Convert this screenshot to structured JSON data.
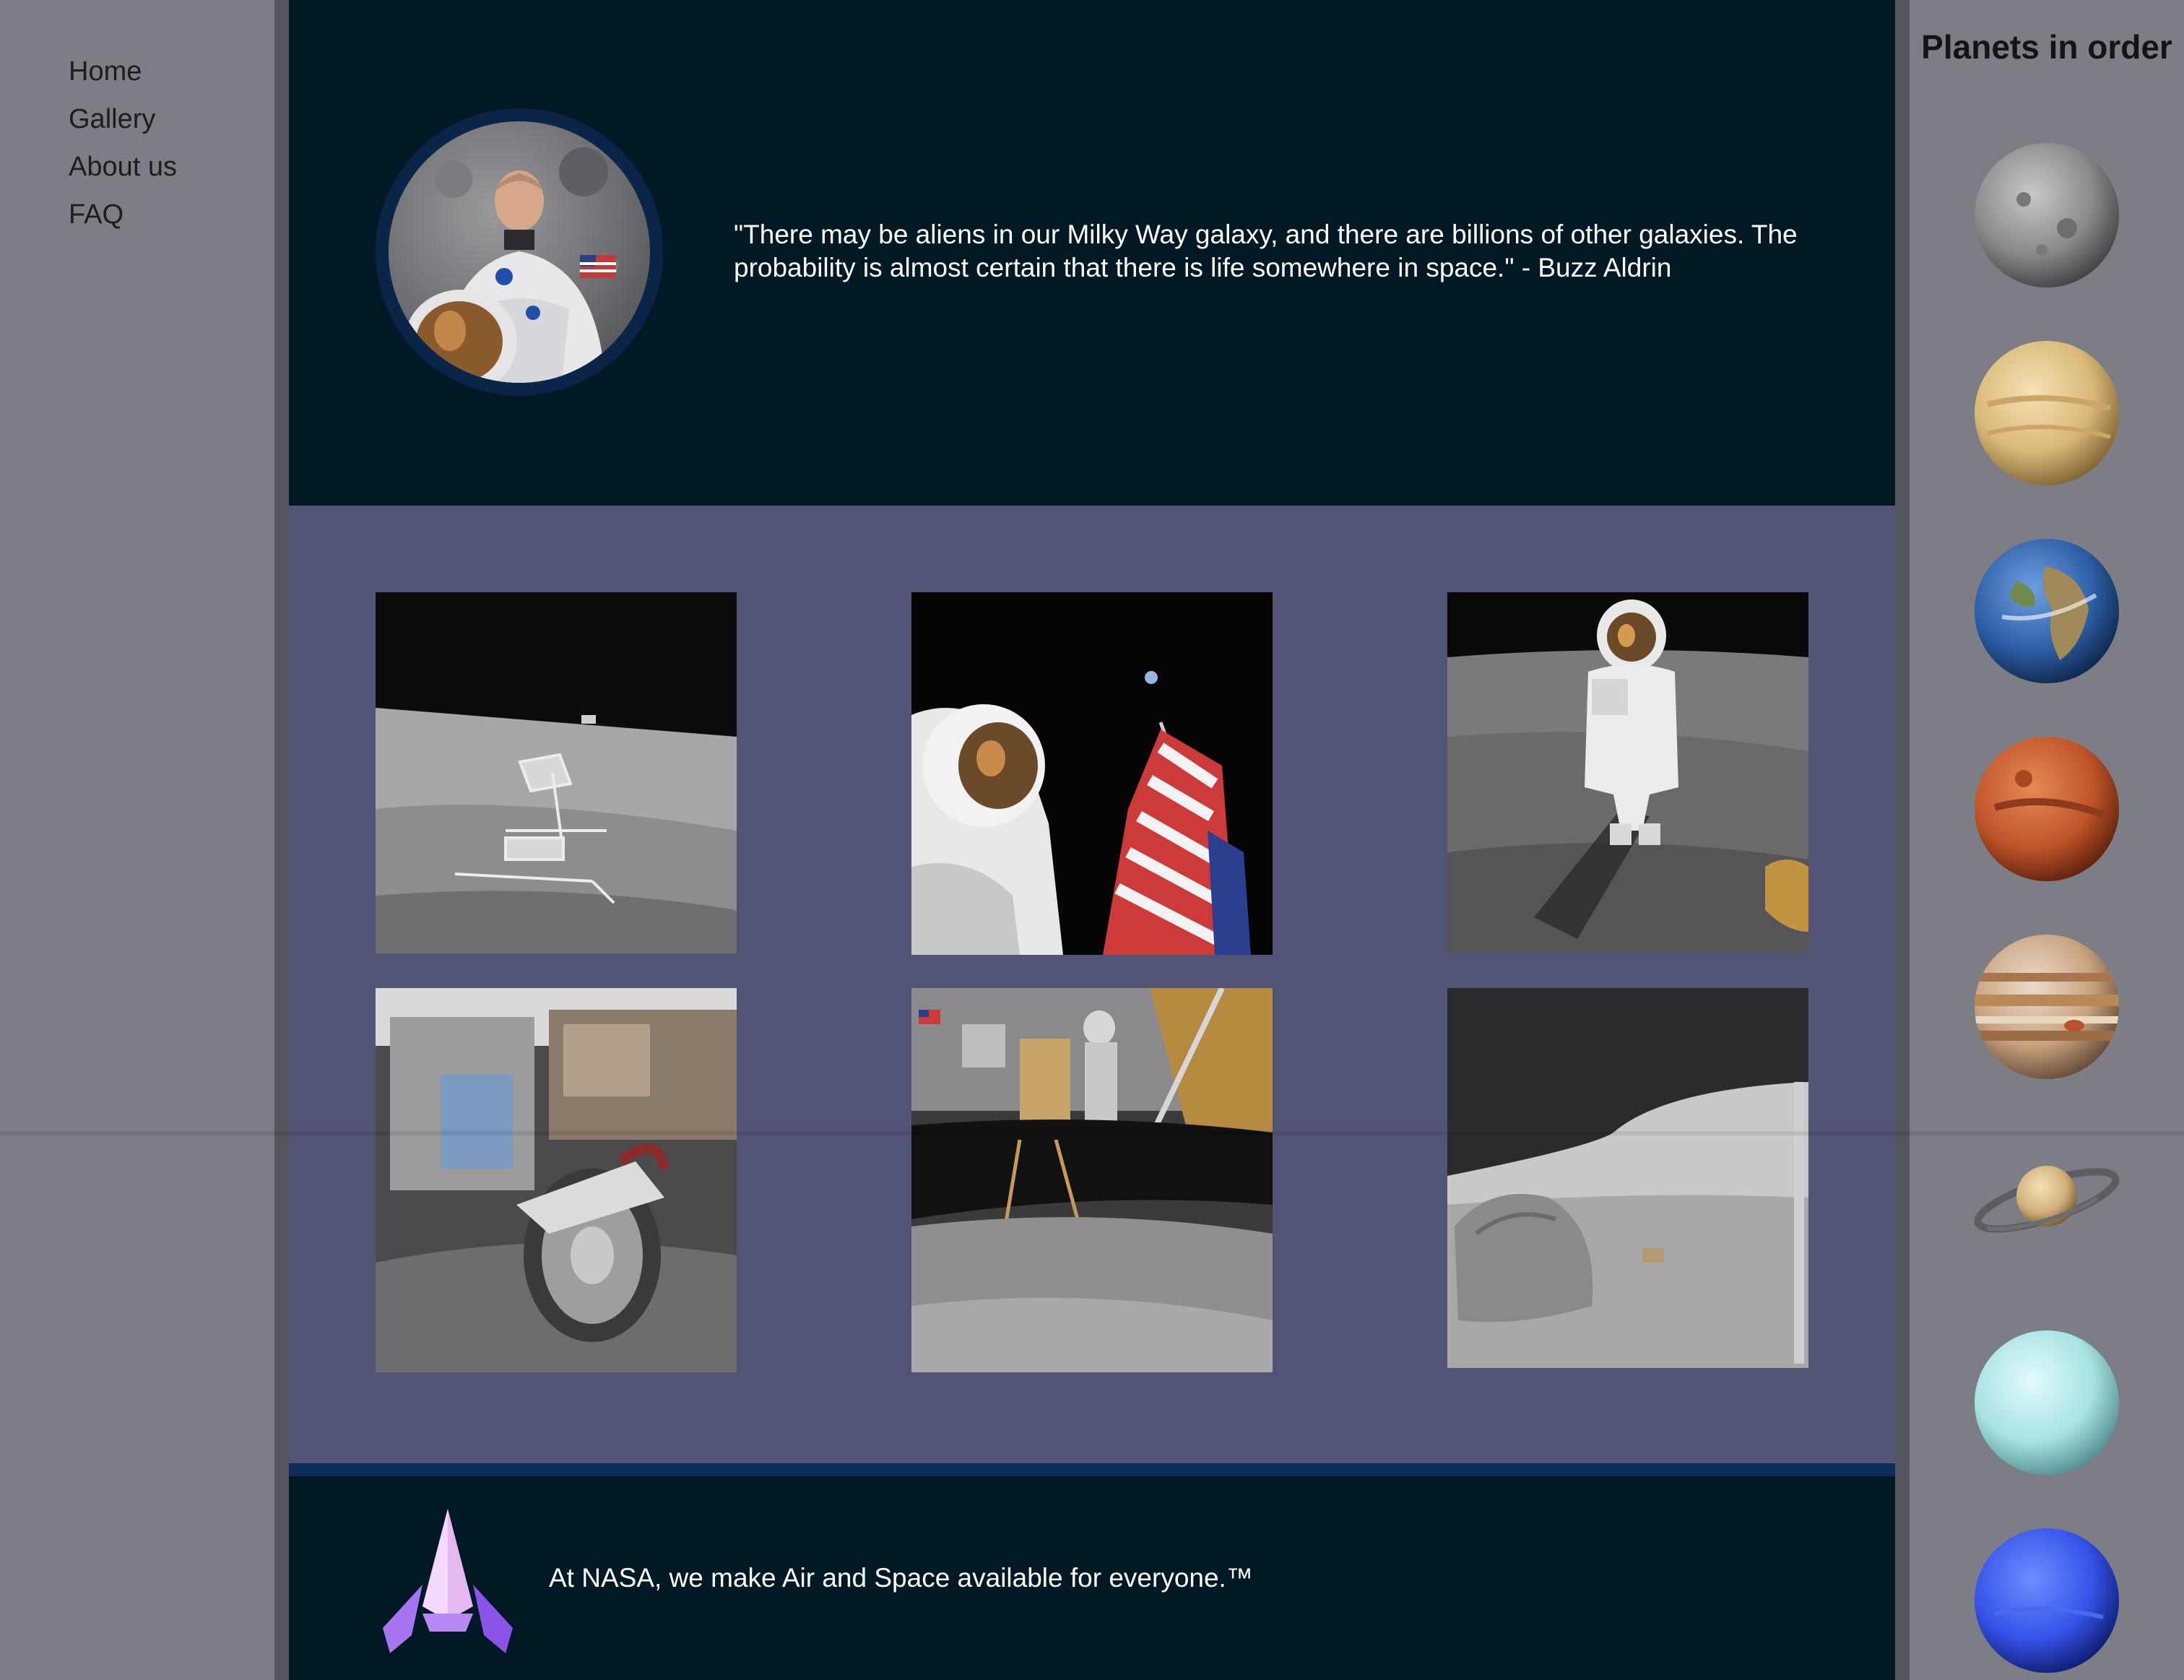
{
  "nav": {
    "items": [
      {
        "label": "Home"
      },
      {
        "label": "Gallery"
      },
      {
        "label": "About us"
      },
      {
        "label": "FAQ"
      }
    ]
  },
  "hero": {
    "avatar_icon": "astronaut-portrait",
    "quote": "\"There may be aliens in our Milky Way galaxy, and there are billions of other galaxies. The probability is almost certain that there is life somewhere in space.\" - Buzz Aldrin"
  },
  "gallery": {
    "images": [
      {
        "subject": "lunar-lander-on-surface"
      },
      {
        "subject": "astronaut-with-flag"
      },
      {
        "subject": "astronaut-walking-on-moon"
      },
      {
        "subject": "lunar-rover-wheel"
      },
      {
        "subject": "astronaut-with-equipment"
      },
      {
        "subject": "moon-boulder-landscape"
      }
    ]
  },
  "footer": {
    "logo_icon": "rocket-icon",
    "tagline": "At NASA, we make Air and Space available for everyone.™"
  },
  "planets": {
    "title": "Planets in order",
    "items": [
      {
        "name": "mercury",
        "color": "#9a9a9a"
      },
      {
        "name": "venus",
        "color": "#e2c58e"
      },
      {
        "name": "earth",
        "color": "#2f5fa8"
      },
      {
        "name": "mars",
        "color": "#c4582c"
      },
      {
        "name": "jupiter",
        "color": "#c9a27c"
      },
      {
        "name": "saturn",
        "color": "#d8c08a"
      },
      {
        "name": "uranus",
        "color": "#b8ecec"
      },
      {
        "name": "neptune",
        "color": "#3a5cf0"
      }
    ]
  },
  "colors": {
    "hero_bg": "#011925",
    "gallery_bg": "#525475",
    "side_bg": "#7c7d85",
    "accent_ring": "#0b2548"
  }
}
